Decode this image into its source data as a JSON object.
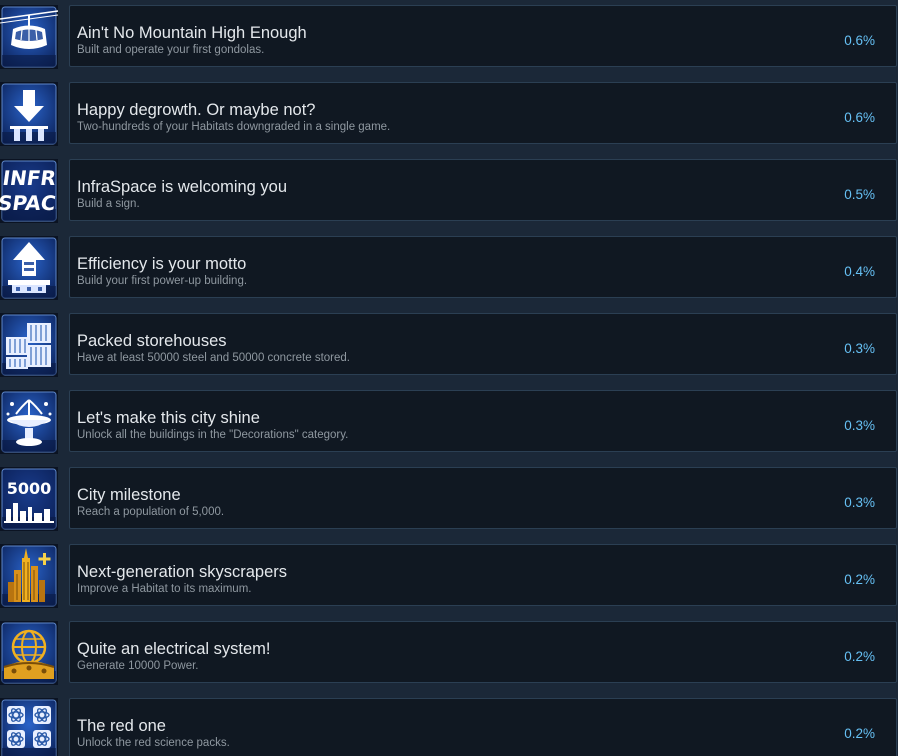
{
  "achievements": [
    {
      "title": "Ain't No Mountain High Enough",
      "description": "Built and operate your first gondolas.",
      "percent": "0.6%",
      "icon": "gondola-icon"
    },
    {
      "title": "Happy degrowth. Or maybe not?",
      "description": "Two-hundreds of your Habitats downgraded in a single game.",
      "percent": "0.6%",
      "icon": "downgrade-arrow-icon"
    },
    {
      "title": "InfraSpace is welcoming you",
      "description": "Build a sign.",
      "percent": "0.5%",
      "icon": "infraspace-sign-icon",
      "icon_text_top": "INFR",
      "icon_text_bottom": "SPAC"
    },
    {
      "title": "Efficiency is your motto",
      "description": "Build your first power-up building.",
      "percent": "0.4%",
      "icon": "power-up-arrow-icon"
    },
    {
      "title": "Packed storehouses",
      "description": "Have at least 50000 steel and 50000 concrete stored.",
      "percent": "0.3%",
      "icon": "storehouse-icon"
    },
    {
      "title": "Let's make this city shine",
      "description": "Unlock all the buildings in the \"Decorations\" category.",
      "percent": "0.3%",
      "icon": "fountain-icon"
    },
    {
      "title": "City milestone",
      "description": "Reach a population of 5,000.",
      "percent": "0.3%",
      "icon": "population-5000-icon",
      "icon_text": "5000"
    },
    {
      "title": "Next-generation skyscrapers",
      "description": "Improve a Habitat to its maximum.",
      "percent": "0.2%",
      "icon": "skyscraper-plus-icon"
    },
    {
      "title": "Quite an electrical system!",
      "description": "Generate 10000 Power.",
      "percent": "0.2%",
      "icon": "power-globe-icon"
    },
    {
      "title": "The red one",
      "description": "Unlock the red science packs.",
      "percent": "0.2%",
      "icon": "science-atom-icon"
    }
  ],
  "colors": {
    "page_background": "#1b2838",
    "card_background": "#101822",
    "card_border": "#2b3f53",
    "title_text": "#e4e8ec",
    "description_text": "#8f98a0",
    "percent_text": "#66c0f4",
    "icon_blue": "#0d3f8a",
    "icon_gold": "#e0a020"
  }
}
